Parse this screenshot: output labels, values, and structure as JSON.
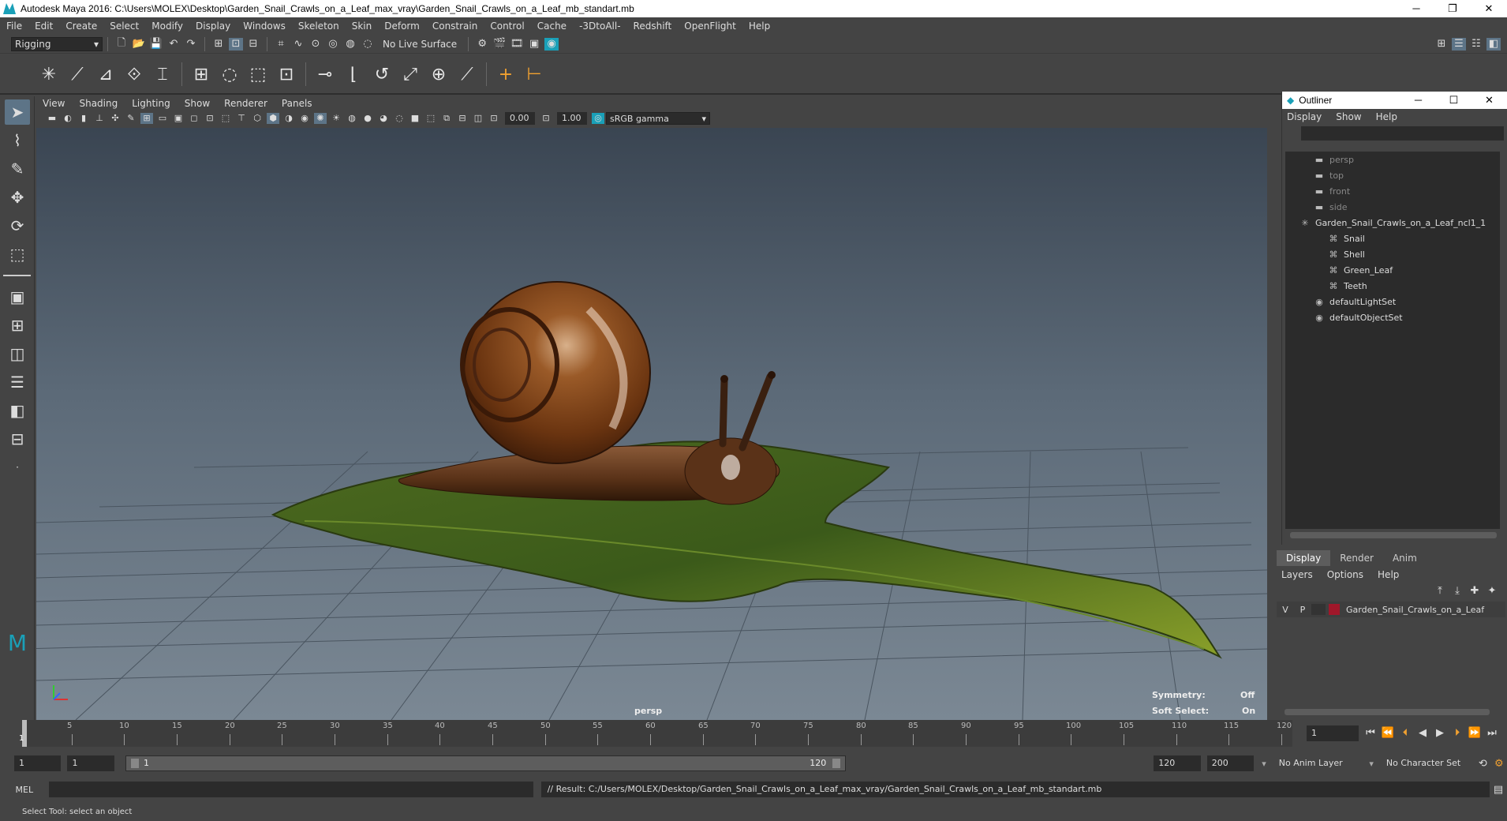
{
  "window": {
    "title": "Autodesk Maya 2016: C:\\Users\\MOLEX\\Desktop\\Garden_Snail_Crawls_on_a_Leaf_max_vray\\Garden_Snail_Crawls_on_a_Leaf_mb_standart.mb",
    "minimize": "─",
    "restore": "❐",
    "close": "✕"
  },
  "menubar": [
    "File",
    "Edit",
    "Create",
    "Select",
    "Modify",
    "Display",
    "Windows",
    "Skeleton",
    "Skin",
    "Deform",
    "Constrain",
    "Control",
    "Cache",
    "-3DtoAll-",
    "Redshift",
    "OpenFlight",
    "Help"
  ],
  "status_line": {
    "menu_set": "Rigging",
    "live_surface": "No Live Surface"
  },
  "viewport": {
    "menu": [
      "View",
      "Shading",
      "Lighting",
      "Show",
      "Renderer",
      "Panels"
    ],
    "exposure": "0.00",
    "gamma": "1.00",
    "color_space": "sRGB gamma",
    "camera_label": "persp",
    "symmetry_label": "Symmetry:",
    "symmetry_value": "Off",
    "soft_select_label": "Soft Select:",
    "soft_select_value": "On"
  },
  "outliner": {
    "title": "Outliner",
    "menu": [
      "Display",
      "Show",
      "Help"
    ],
    "items": [
      {
        "label": "persp",
        "indent": 2,
        "dim": true,
        "icon": "camera-icon"
      },
      {
        "label": "top",
        "indent": 2,
        "dim": true,
        "icon": "camera-icon"
      },
      {
        "label": "front",
        "indent": 2,
        "dim": true,
        "icon": "camera-icon"
      },
      {
        "label": "side",
        "indent": 2,
        "dim": true,
        "icon": "camera-icon"
      },
      {
        "label": "Garden_Snail_Crawls_on_a_Leaf_ncl1_1",
        "indent": 1,
        "dim": false,
        "icon": "group-icon"
      },
      {
        "label": "Snail",
        "indent": 3,
        "dim": false,
        "icon": "mesh-icon"
      },
      {
        "label": "Shell",
        "indent": 3,
        "dim": false,
        "icon": "mesh-icon"
      },
      {
        "label": "Green_Leaf",
        "indent": 3,
        "dim": false,
        "icon": "mesh-icon"
      },
      {
        "label": "Teeth",
        "indent": 3,
        "dim": false,
        "icon": "mesh-icon"
      },
      {
        "label": "defaultLightSet",
        "indent": 2,
        "dim": false,
        "icon": "set-icon"
      },
      {
        "label": "defaultObjectSet",
        "indent": 2,
        "dim": false,
        "icon": "set-icon"
      }
    ]
  },
  "layer_editor": {
    "tabs": [
      "Display",
      "Render",
      "Anim"
    ],
    "menu": [
      "Layers",
      "Options",
      "Help"
    ],
    "layer": {
      "v": "V",
      "p": "P",
      "name": "Garden_Snail_Crawls_on_a_Leaf",
      "color": "#a0172a"
    }
  },
  "timeline": {
    "ticks": [
      "5",
      "10",
      "15",
      "20",
      "25",
      "30",
      "35",
      "40",
      "45",
      "50",
      "55",
      "60",
      "65",
      "70",
      "75",
      "80",
      "85",
      "90",
      "95",
      "100",
      "105",
      "110",
      "115",
      "120"
    ],
    "current_frame": "1",
    "current_marker": "1"
  },
  "range": {
    "start": "1",
    "playback_start": "1",
    "slider_start": "1",
    "slider_end": "120",
    "playback_end": "120",
    "end": "200",
    "anim_layer": "No Anim Layer",
    "character_set": "No Character Set"
  },
  "command": {
    "language": "MEL",
    "result": "// Result: C:/Users/MOLEX/Desktop/Garden_Snail_Crawls_on_a_Leaf_max_vray/Garden_Snail_Crawls_on_a_Leaf_mb_standart.mb"
  },
  "help_line": "Select Tool: select an object"
}
